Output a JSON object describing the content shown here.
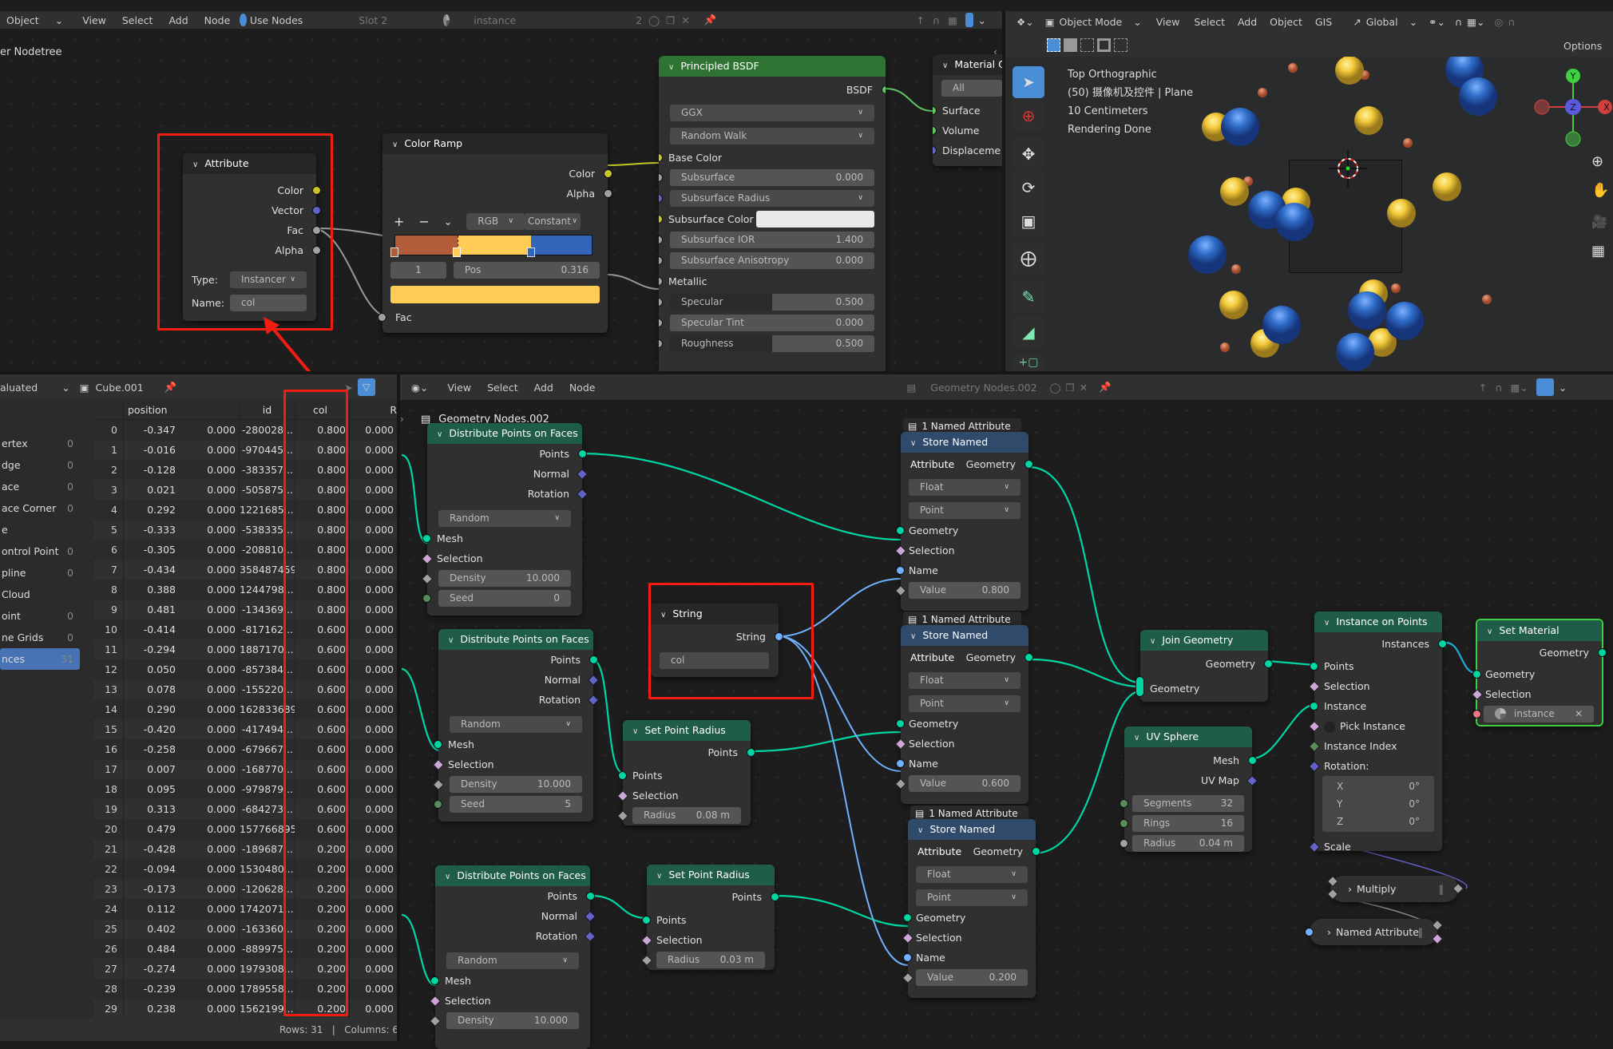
{
  "top_header": {
    "mode_label": "Object",
    "menus": [
      "View",
      "Select",
      "Add",
      "Node"
    ],
    "use_nodes_label": "Use Nodes",
    "slot_label": "Slot 2",
    "material_name": "instance",
    "user_count": "2"
  },
  "shader_editor": {
    "breadcrumb": "er Nodetree",
    "attribute_node": {
      "title": "Attribute",
      "outputs": [
        "Color",
        "Vector",
        "Fac",
        "Alpha"
      ],
      "type_label": "Type:",
      "type_value": "Instancer",
      "name_label": "Name:",
      "name_value": "col"
    },
    "color_ramp_node": {
      "title": "Color Ramp",
      "outputs": [
        "Color",
        "Alpha"
      ],
      "add_icon": "+",
      "remove_icon": "−",
      "color_mode": "RGB",
      "interpolation": "Constant",
      "stops": [
        {
          "position": 0.0,
          "color": "#b35c3a"
        },
        {
          "position": 0.316,
          "color": "#ffcc55"
        },
        {
          "position": 0.69,
          "color": "#3366b8"
        }
      ],
      "active_index": "1",
      "pos_label": "Pos",
      "pos_value": "0.316",
      "active_color": "#ffcc55",
      "input": "Fac"
    },
    "principled_node": {
      "title": "Principled BSDF",
      "output": "BSDF",
      "distribution": "GGX",
      "subsurface_method": "Random Walk",
      "inputs": [
        {
          "label": "Base Color",
          "kind": "socket"
        },
        {
          "label": "Subsurface",
          "value": "0.000"
        },
        {
          "label": "Subsurface Radius",
          "kind": "dropdown"
        },
        {
          "label": "Subsurface Color",
          "kind": "color",
          "color": "#e8e8e8"
        },
        {
          "label": "Subsurface IOR",
          "value": "1.400"
        },
        {
          "label": "Subsurface Anisotropy",
          "value": "0.000"
        },
        {
          "label": "Metallic",
          "kind": "socket"
        },
        {
          "label": "Specular",
          "value": "0.500"
        },
        {
          "label": "Specular Tint",
          "value": "0.000"
        },
        {
          "label": "Roughness",
          "value": "0.500"
        }
      ]
    },
    "material_output_node": {
      "title": "Material O",
      "target": "All",
      "inputs": [
        "Surface",
        "Volume",
        "Displaceme"
      ]
    }
  },
  "viewport": {
    "header": {
      "mode": "Object Mode",
      "menus": [
        "View",
        "Select",
        "Add",
        "Object",
        "GIS"
      ],
      "orientation": "Global",
      "options_label": "Options"
    },
    "overlay_text": [
      "Top Orthographic",
      "(50) 摄像机及控件 | Plane",
      "10 Centimeters",
      "Rendering Done"
    ],
    "gizmo_axes": [
      "X",
      "Y",
      "Z"
    ]
  },
  "spreadsheet": {
    "header": {
      "display_mode": "aluated",
      "object": "Cube.001"
    },
    "domains": [
      {
        "label": "ertex",
        "count": "0"
      },
      {
        "label": "dge",
        "count": "0"
      },
      {
        "label": "ace",
        "count": "0"
      },
      {
        "label": "ace Corner",
        "count": "0"
      },
      {
        "label": "e",
        "count": ""
      },
      {
        "label": "ontrol Point",
        "count": "0"
      },
      {
        "label": "pline",
        "count": "0"
      },
      {
        "label": "Cloud",
        "count": ""
      },
      {
        "label": "oint",
        "count": "0"
      },
      {
        "label": "ne Grids",
        "count": "0"
      },
      {
        "label": "nces",
        "count": "31",
        "active": true
      }
    ],
    "columns": [
      "position",
      "id",
      "col",
      "R"
    ],
    "rows": [
      [
        "0",
        "-0.347",
        "0.000",
        "-280028...",
        "0.800",
        "0.000"
      ],
      [
        "1",
        "-0.016",
        "0.000",
        "-970445...",
        "0.800",
        "0.000"
      ],
      [
        "2",
        "-0.128",
        "0.000",
        "-383357...",
        "0.800",
        "0.000"
      ],
      [
        "3",
        "0.021",
        "0.000",
        "-505875...",
        "0.800",
        "0.000"
      ],
      [
        "4",
        "0.292",
        "0.000",
        "1221685...",
        "0.800",
        "0.000"
      ],
      [
        "5",
        "-0.333",
        "0.000",
        "-538335...",
        "0.800",
        "0.000"
      ],
      [
        "6",
        "-0.305",
        "0.000",
        "-208810...",
        "0.800",
        "0.000"
      ],
      [
        "7",
        "-0.434",
        "0.000",
        "358487459",
        "0.800",
        "0.000"
      ],
      [
        "8",
        "0.388",
        "0.000",
        "1244798...",
        "0.800",
        "0.000"
      ],
      [
        "9",
        "0.481",
        "0.000",
        "-134369...",
        "0.800",
        "0.000"
      ],
      [
        "10",
        "-0.414",
        "0.000",
        "-817162...",
        "0.600",
        "0.000"
      ],
      [
        "11",
        "-0.294",
        "0.000",
        "1887170...",
        "0.600",
        "0.000"
      ],
      [
        "12",
        "0.050",
        "0.000",
        "-857384...",
        "0.600",
        "0.000"
      ],
      [
        "13",
        "0.078",
        "0.000",
        "-155220...",
        "0.600",
        "0.000"
      ],
      [
        "14",
        "0.290",
        "0.000",
        "162833689",
        "0.600",
        "0.000"
      ],
      [
        "15",
        "-0.420",
        "0.000",
        "-417494...",
        "0.600",
        "0.000"
      ],
      [
        "16",
        "-0.258",
        "0.000",
        "-679667...",
        "0.600",
        "0.000"
      ],
      [
        "17",
        "0.007",
        "0.000",
        "-168770...",
        "0.600",
        "0.000"
      ],
      [
        "18",
        "0.095",
        "0.000",
        "-979879...",
        "0.600",
        "0.000"
      ],
      [
        "19",
        "0.313",
        "0.000",
        "-684273...",
        "0.600",
        "0.000"
      ],
      [
        "20",
        "0.479",
        "0.000",
        "157766895",
        "0.600",
        "0.000"
      ],
      [
        "21",
        "-0.428",
        "0.000",
        "-189687...",
        "0.200",
        "0.000"
      ],
      [
        "22",
        "-0.094",
        "0.000",
        "1530480...",
        "0.200",
        "0.000"
      ],
      [
        "23",
        "-0.173",
        "0.000",
        "-120628...",
        "0.200",
        "0.000"
      ],
      [
        "24",
        "0.112",
        "0.000",
        "1742071...",
        "0.200",
        "0.000"
      ],
      [
        "25",
        "0.402",
        "0.000",
        "-163360...",
        "0.200",
        "0.000"
      ],
      [
        "26",
        "0.484",
        "0.000",
        "-889975...",
        "0.200",
        "0.000"
      ],
      [
        "27",
        "-0.274",
        "0.000",
        "1979308...",
        "0.200",
        "0.000"
      ],
      [
        "28",
        "-0.239",
        "0.000",
        "1789558...",
        "0.200",
        "0.000"
      ],
      [
        "29",
        "0.238",
        "0.000",
        "1562199...",
        "0.200",
        "0.000"
      ]
    ],
    "footer": "Rows: 31   |   Columns: 6"
  },
  "geo_editor": {
    "header": {
      "menus": [
        "View",
        "Select",
        "Add",
        "Node"
      ],
      "tree_name": "Geometry Nodes.002"
    },
    "breadcrumb": "Geometry Nodes.002",
    "distribute_nodes": [
      {
        "title": "Distribute Points on Faces",
        "outputs": [
          "Points",
          "Normal",
          "Rotation"
        ],
        "mode": "Random",
        "inputs": [
          "Mesh",
          "Selection"
        ],
        "density_label": "Density",
        "density": "10.000",
        "seed_label": "Seed",
        "seed": "0"
      },
      {
        "title": "Distribute Points on Faces",
        "outputs": [
          "Points",
          "Normal",
          "Rotation"
        ],
        "mode": "Random",
        "inputs": [
          "Mesh",
          "Selection"
        ],
        "density_label": "Density",
        "density": "10.000",
        "seed_label": "Seed",
        "seed": "5"
      },
      {
        "title": "Distribute Points on Faces",
        "outputs": [
          "Points",
          "Normal",
          "Rotation"
        ],
        "mode": "Random",
        "inputs": [
          "Mesh",
          "Selection"
        ],
        "density_label": "Density",
        "density": "10.000"
      }
    ],
    "string_node": {
      "title": "String",
      "output": "String",
      "value": "col"
    },
    "set_radius_nodes": [
      {
        "title": "Set Point Radius",
        "output": "Points",
        "inputs": [
          "Points",
          "Selection"
        ],
        "radius_label": "Radius",
        "radius": "0.08 m"
      },
      {
        "title": "Set Point Radius",
        "output": "Points",
        "inputs": [
          "Points",
          "Selection"
        ],
        "radius_label": "Radius",
        "radius": "0.03 m"
      }
    ],
    "store_nodes": [
      {
        "badge": "1 Named Attribute",
        "title": "Store Named Attribute",
        "output": "Geometry",
        "data_type": "Float",
        "domain": "Point",
        "inputs": [
          "Geometry",
          "Selection",
          "Name"
        ],
        "value_label": "Value",
        "value": "0.800"
      },
      {
        "badge": "1 Named Attribute",
        "title": "Store Named Attribute",
        "output": "Geometry",
        "data_type": "Float",
        "domain": "Point",
        "inputs": [
          "Geometry",
          "Selection",
          "Name"
        ],
        "value_label": "Value",
        "value": "0.600"
      },
      {
        "badge": "1 Named Attribute",
        "title": "Store Named Attribute",
        "output": "Geometry",
        "data_type": "Float",
        "domain": "Point",
        "inputs": [
          "Geometry",
          "Selection",
          "Name"
        ],
        "value_label": "Value",
        "value": "0.200"
      }
    ],
    "join_node": {
      "title": "Join Geometry",
      "output": "Geometry",
      "input": "Geometry"
    },
    "uv_sphere_node": {
      "title": "UV Sphere",
      "outputs": [
        "Mesh",
        "UV Map"
      ],
      "segments_label": "Segments",
      "segments": "32",
      "rings_label": "Rings",
      "rings": "16",
      "radius_label": "Radius",
      "radius": "0.04 m"
    },
    "instance_node": {
      "title": "Instance on Points",
      "output": "Instances",
      "inputs": [
        "Points",
        "Selection",
        "Instance",
        "Pick Instance",
        "Instance Index",
        "Rotation:"
      ],
      "rotation": [
        {
          "axis": "X",
          "value": "0°"
        },
        {
          "axis": "Y",
          "value": "0°"
        },
        {
          "axis": "Z",
          "value": "0°"
        }
      ],
      "scale_label": "Scale"
    },
    "set_material_node": {
      "title": "Set Material",
      "output": "Geometry",
      "inputs": [
        "Geometry",
        "Selection"
      ],
      "material": "instance"
    },
    "multiply_node": {
      "title": "Multiply"
    },
    "named_attr_node": {
      "title": "Named Attribute"
    }
  }
}
